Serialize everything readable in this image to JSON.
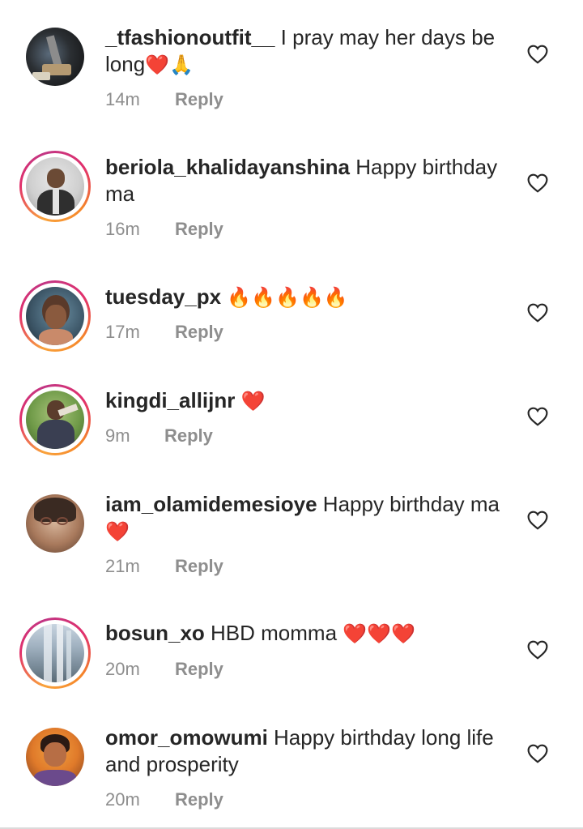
{
  "comments": [
    {
      "username": "_tfashionoutfit__",
      "text": " I pray may her days be long",
      "emoji": "❤️🙏",
      "time": "14m",
      "reply": "Reply",
      "avatar": "tailor-photo",
      "ring": false
    },
    {
      "username": "beriola_khalidayanshina",
      "text": " Happy birthday ma",
      "emoji": "",
      "time": "16m",
      "reply": "Reply",
      "avatar": "man-in-suit-photo",
      "ring": true
    },
    {
      "username": "tuesday_px",
      "text": " ",
      "emoji": "🔥🔥🔥🔥🔥",
      "time": "17m",
      "reply": "Reply",
      "avatar": "woman-portrait-photo",
      "ring": true
    },
    {
      "username": "kingdi_allijnr",
      "text": " ",
      "emoji": "❤️",
      "time": "9m",
      "reply": "Reply",
      "avatar": "man-outdoor-photo",
      "ring": true
    },
    {
      "username": "iam_olamidemesioye",
      "text": " Happy birthday ma",
      "emoji": "❤️",
      "time": "21m",
      "reply": "Reply",
      "avatar": "woman-glasses-photo",
      "ring": false
    },
    {
      "username": "bosun_xo",
      "text": " HBD momma ",
      "emoji": "❤️❤️❤️",
      "time": "20m",
      "reply": "Reply",
      "avatar": "waterfall-photo",
      "ring": true
    },
    {
      "username": "omor_omowumi",
      "text": " Happy birthday long life and prosperity",
      "emoji": "",
      "time": "20m",
      "reply": "Reply",
      "avatar": "woman-selfie-photo",
      "ring": false
    }
  ],
  "icons": {
    "like": "heart-outline-icon"
  },
  "colors": {
    "text": "#262626",
    "meta": "#8e8e8e",
    "heart": "#262626"
  }
}
